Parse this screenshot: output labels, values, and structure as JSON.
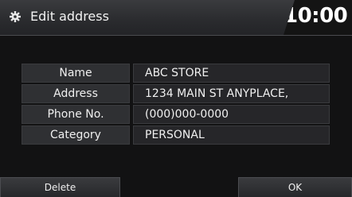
{
  "header": {
    "title": "Edit address",
    "icon": "gear-icon",
    "clock": "10:00"
  },
  "fields": [
    {
      "label": "Name",
      "value": "ABC STORE"
    },
    {
      "label": "Address",
      "value": "1234 MAIN ST ANYPLACE,"
    },
    {
      "label": "Phone No.",
      "value": "(000)000-0000"
    },
    {
      "label": "Category",
      "value": "PERSONAL"
    }
  ],
  "buttons": {
    "delete": "Delete",
    "ok": "OK"
  },
  "colors": {
    "background": "#121213",
    "header": "#2a2b2e",
    "label_cell": "#2f3033",
    "value_cell": "#262629",
    "text": "#f0f0f0"
  }
}
